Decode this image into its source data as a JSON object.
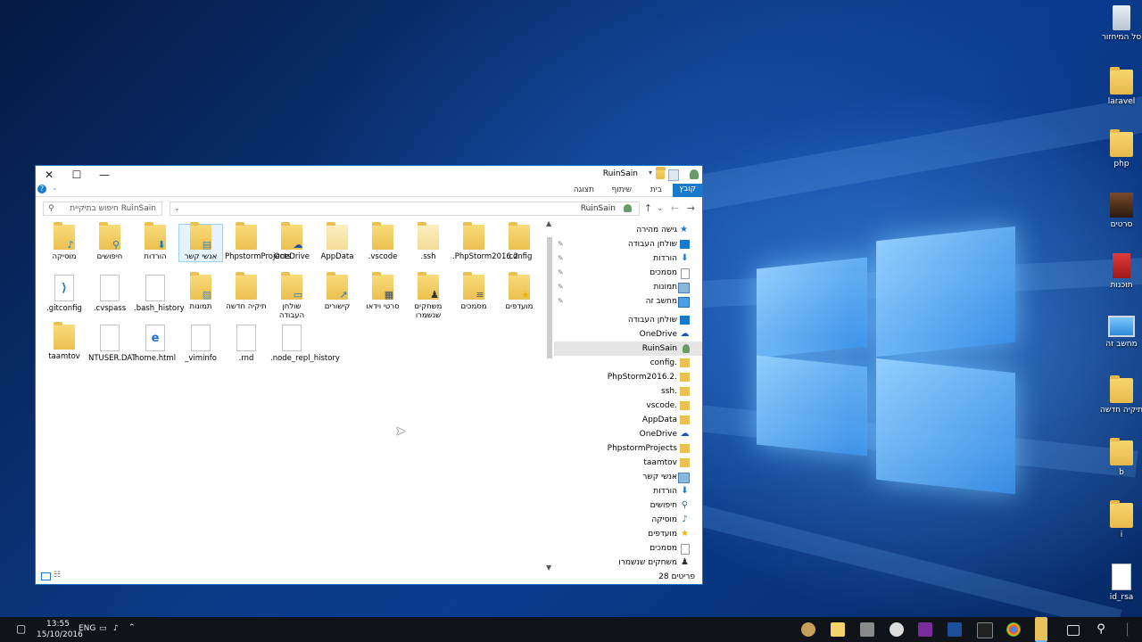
{
  "desktop": {
    "icons": [
      {
        "label": "סל המיחזור",
        "icon": "recycle-bin-icon"
      },
      {
        "label": "laravel",
        "icon": "folder-icon"
      },
      {
        "label": "php",
        "icon": "folder-icon"
      },
      {
        "label": "סרטים",
        "icon": "movie-shortcut-icon"
      },
      {
        "label": "תוכנות",
        "icon": "archive-icon"
      },
      {
        "label": "מחשב זה",
        "icon": "this-pc-icon"
      },
      {
        "label": "תיקיה חדשה",
        "icon": "folder-icon"
      },
      {
        "label": "b",
        "icon": "folder-icon"
      },
      {
        "label": "i",
        "icon": "folder-icon"
      },
      {
        "label": "id_rsa",
        "icon": "file-icon"
      }
    ]
  },
  "window": {
    "title": "RuinSain",
    "ribbon_tabs": [
      "קובץ",
      "בית",
      "שיתוף",
      "תצוגה"
    ],
    "address_path": "RuinSain",
    "search_placeholder": "חיפוש בתיקיית RuinSain",
    "nav_quick_access": "גישה מהירה",
    "nav_items": [
      {
        "label": "שולחן העבודה",
        "icon": "desktop-icon",
        "pinned": true
      },
      {
        "label": "הורדות",
        "icon": "downloads-icon",
        "pinned": true
      },
      {
        "label": "מסמכים",
        "icon": "documents-icon",
        "pinned": true
      },
      {
        "label": "תמונות",
        "icon": "pictures-icon",
        "pinned": true
      },
      {
        "label": "מחשב זה",
        "icon": "this-pc-icon",
        "pinned": true
      }
    ],
    "nav_tree": [
      {
        "label": "שולחן העבודה",
        "icon": "desktop-icon"
      },
      {
        "label": "OneDrive",
        "icon": "onedrive-icon"
      },
      {
        "label": "RuinSain",
        "icon": "user-icon",
        "selected": true
      },
      {
        "label": "config.",
        "icon": "folder-icon"
      },
      {
        "label": "PhpStorm2016.2.",
        "icon": "folder-icon"
      },
      {
        "label": "ssh.",
        "icon": "folder-icon"
      },
      {
        "label": "vscode.",
        "icon": "folder-icon"
      },
      {
        "label": "AppData",
        "icon": "folder-icon"
      },
      {
        "label": "OneDrive",
        "icon": "onedrive-icon"
      },
      {
        "label": "PhpstormProjects",
        "icon": "folder-icon"
      },
      {
        "label": "taamtov",
        "icon": "folder-icon"
      },
      {
        "label": "אנשי קשר",
        "icon": "contacts-icon"
      },
      {
        "label": "הורדות",
        "icon": "downloads-icon"
      },
      {
        "label": "חיפושים",
        "icon": "searches-icon"
      },
      {
        "label": "מוסיקה",
        "icon": "music-icon"
      },
      {
        "label": "מועדפים",
        "icon": "favorites-icon"
      },
      {
        "label": "מסמכים",
        "icon": "documents-icon"
      },
      {
        "label": "משחקים שנשמרו",
        "icon": "saved-games-icon"
      }
    ],
    "items": [
      {
        "label": "מוסיקה",
        "kind": "folder",
        "badge": "music-note-icon"
      },
      {
        "label": "חיפושים",
        "kind": "folder",
        "badge": "magnifier-icon"
      },
      {
        "label": "הורדות",
        "kind": "folder",
        "badge": "download-arrow-icon"
      },
      {
        "label": "אנשי קשר",
        "kind": "folder",
        "badge": "contact-card-icon",
        "selected": true
      },
      {
        "label": "PhpstormProjects",
        "kind": "folder"
      },
      {
        "label": "OneDrive",
        "kind": "folder",
        "badge": "cloud-icon"
      },
      {
        "label": "AppData",
        "kind": "folder-light"
      },
      {
        "label": ".vscode",
        "kind": "folder"
      },
      {
        "label": ".ssh",
        "kind": "folder-light"
      },
      {
        "label": ".PhpStorm2016.2",
        "kind": "folder"
      },
      {
        "label": ".config",
        "kind": "folder"
      },
      {
        "label": ".gitconfig",
        "kind": "file",
        "badge": "vscode-logo-icon"
      },
      {
        "label": ".cvspass",
        "kind": "file"
      },
      {
        "label": ".bash_history",
        "kind": "file"
      },
      {
        "label": "תמונות",
        "kind": "folder",
        "badge": "picture-icon"
      },
      {
        "label": "תיקיה חדשה",
        "kind": "folder"
      },
      {
        "label": "שולחן העבודה",
        "kind": "folder",
        "badge": "monitor-icon"
      },
      {
        "label": "קישורים",
        "kind": "folder",
        "badge": "shortcut-arrow-icon"
      },
      {
        "label": "סרטי וידאו",
        "kind": "folder",
        "badge": "film-icon"
      },
      {
        "label": "משחקים שנשמרו",
        "kind": "folder",
        "badge": "chess-piece-icon"
      },
      {
        "label": "מסמכים",
        "kind": "folder",
        "badge": "document-icon"
      },
      {
        "label": "מועדפים",
        "kind": "folder",
        "badge": "star-icon"
      },
      {
        "label": "taamtov",
        "kind": "folder"
      },
      {
        "label": "NTUSER.DAT",
        "kind": "file"
      },
      {
        "label": "home.html",
        "kind": "file",
        "badge": "edge-logo-icon"
      },
      {
        "label": "_viminfo",
        "kind": "file"
      },
      {
        "label": ".rnd",
        "kind": "file"
      },
      {
        "label": ".node_repl_history",
        "kind": "file"
      }
    ],
    "status_count": "28 פריטים"
  },
  "taskbar": {
    "time": "13:55",
    "date": "15/10/2016",
    "language": "ENG"
  },
  "colors": {
    "accent": "#1979ca",
    "folder": "#eac050",
    "taskbar": "#101317"
  }
}
